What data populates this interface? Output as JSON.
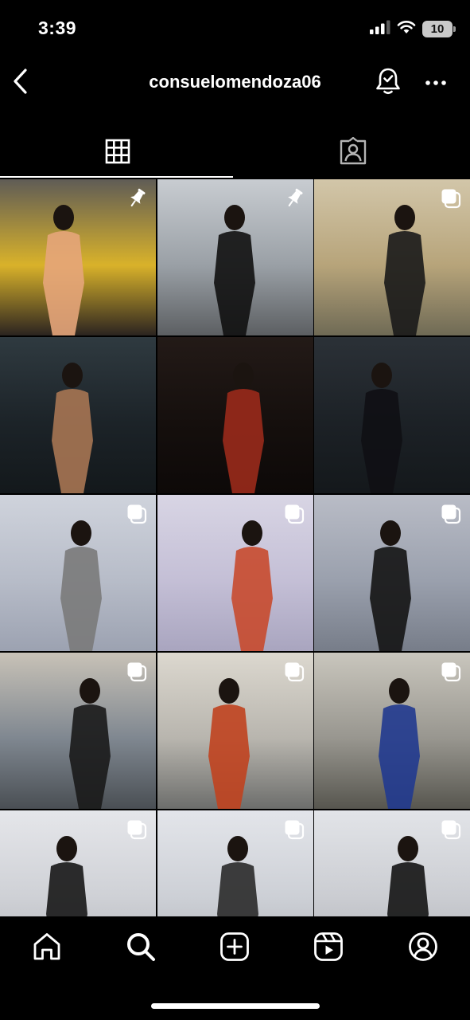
{
  "status_bar": {
    "time": "3:39",
    "battery_level": "10",
    "signal_icon": "cellular-signal-icon",
    "wifi_icon": "wifi-icon"
  },
  "header": {
    "username": "consuelomendoza06",
    "back_icon": "chevron-left-icon",
    "notifications_icon": "bell-icon",
    "more_icon": "ellipsis-icon"
  },
  "tabs": [
    {
      "icon": "grid-icon",
      "active": true
    },
    {
      "icon": "tagged-icon",
      "active": false
    }
  ],
  "posts": [
    {
      "badge": "pinned-icon",
      "colors": [
        "#5f5c56",
        "#d9b22a",
        "#2b2420"
      ],
      "figure": "#e6a57a"
    },
    {
      "badge": "pinned-icon",
      "colors": [
        "#c8ccd1",
        "#9aa0a6",
        "#5c5f62"
      ],
      "figure": "#111111"
    },
    {
      "badge": "carousel-icon",
      "colors": [
        "#d2c6a9",
        "#b7a47a",
        "#6f6a55"
      ],
      "figure": "#1a1a1a"
    },
    {
      "badge": "",
      "colors": [
        "#2f3a40",
        "#1c2328",
        "#13181b"
      ],
      "figure": "#a77653"
    },
    {
      "badge": "",
      "colors": [
        "#231a17",
        "#150f0d",
        "#0d0908"
      ],
      "figure": "#9a2a1b"
    },
    {
      "badge": "",
      "colors": [
        "#2b3137",
        "#1c2126",
        "#14181b"
      ],
      "figure": "#0f0f14"
    },
    {
      "badge": "carousel-icon",
      "colors": [
        "#cfd3dc",
        "#b7bcc8",
        "#9ca2b1"
      ],
      "figure": "#7a7a7a"
    },
    {
      "badge": "carousel-icon",
      "colors": [
        "#d8d5e4",
        "#c4bfd6",
        "#a9a5bf"
      ],
      "figure": "#c84a2d"
    },
    {
      "badge": "carousel-icon",
      "colors": [
        "#b9bcc6",
        "#9aa0ad",
        "#777d89"
      ],
      "figure": "#141414"
    },
    {
      "badge": "carousel-icon",
      "colors": [
        "#c8c2b7",
        "#7f8790",
        "#4a4f54"
      ],
      "figure": "#1a1a1a"
    },
    {
      "badge": "carousel-icon",
      "colors": [
        "#dcd8cf",
        "#b8b5ae",
        "#6d6e6c"
      ],
      "figure": "#c0431f"
    },
    {
      "badge": "carousel-icon",
      "colors": [
        "#c9c6bd",
        "#98968f",
        "#57564f"
      ],
      "figure": "#213a8f"
    },
    {
      "badge": "carousel-icon",
      "colors": [
        "#e5e6ea",
        "#cfd1d6",
        "#b2b4ba"
      ],
      "figure": "#171717"
    },
    {
      "badge": "carousel-icon",
      "colors": [
        "#e3e5ea",
        "#cdd0d6",
        "#b0b3b9"
      ],
      "figure": "#2a2a2a"
    },
    {
      "badge": "carousel-icon",
      "colors": [
        "#e2e4e8",
        "#cbcdd2",
        "#aeb0b6"
      ],
      "figure": "#141414"
    }
  ],
  "bottom_nav": [
    {
      "icon": "home-icon"
    },
    {
      "icon": "search-icon"
    },
    {
      "icon": "new-post-icon"
    },
    {
      "icon": "reels-icon"
    },
    {
      "icon": "profile-icon"
    }
  ]
}
